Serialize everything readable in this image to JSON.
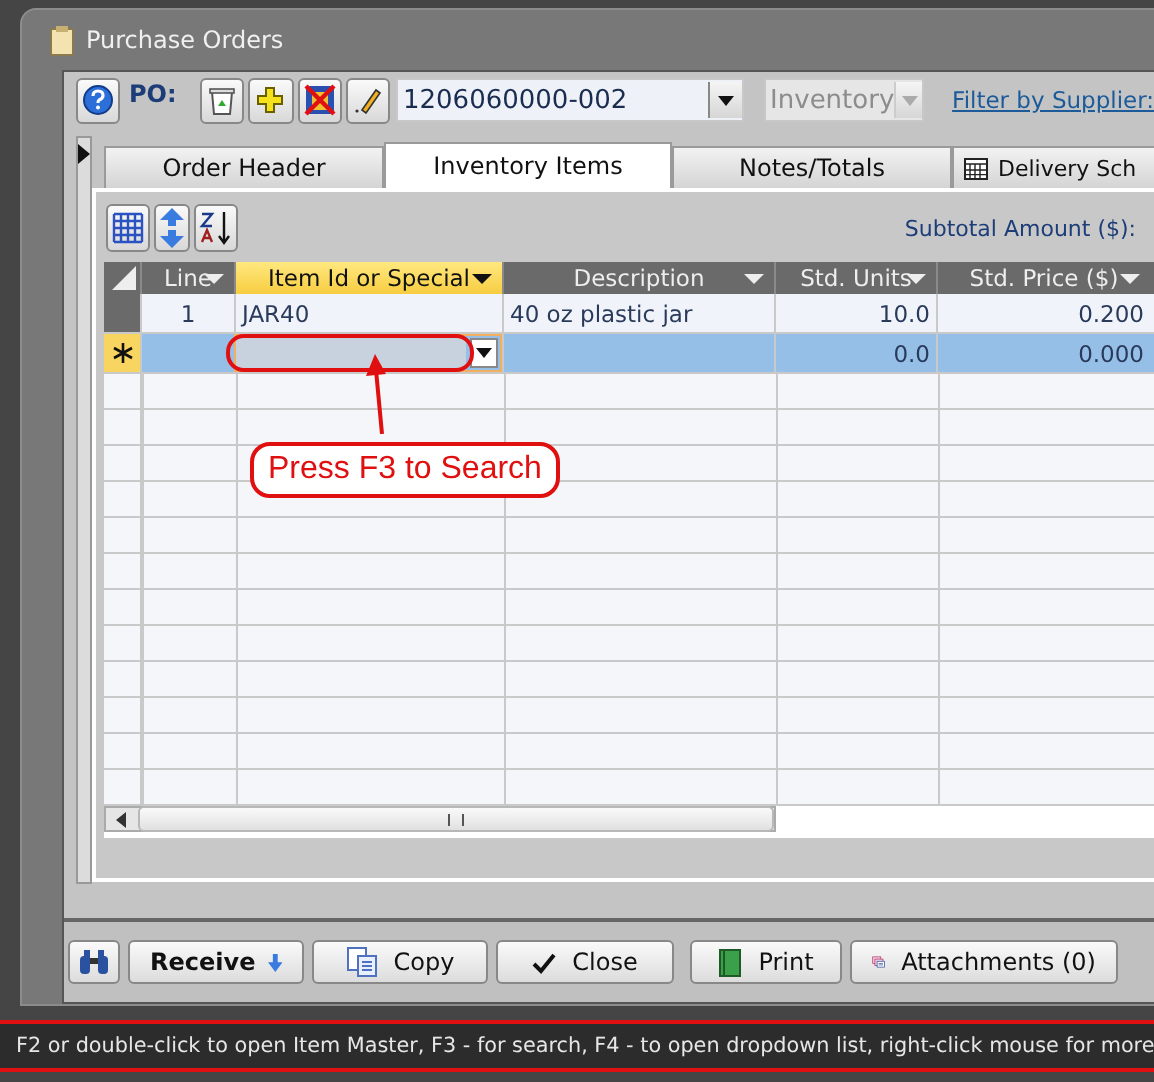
{
  "window": {
    "title": "Purchase Orders"
  },
  "toolbar": {
    "po_label": "PO:",
    "po_number": "1206060000-002",
    "type": "Inventory",
    "type_disabled": true,
    "filter_link": "Filter by Supplier:"
  },
  "tabs": [
    {
      "label": "Order Header",
      "selected": false
    },
    {
      "label": "Inventory Items",
      "selected": true
    },
    {
      "label": "Notes/Totals",
      "selected": false
    },
    {
      "label": "Delivery Sch",
      "selected": false
    }
  ],
  "subtotal_label": "Subtotal Amount ($):",
  "table": {
    "columns": [
      {
        "label": "Line",
        "selected": false
      },
      {
        "label": "Item Id or Special",
        "selected": true
      },
      {
        "label": "Description",
        "selected": false
      },
      {
        "label": "Std. Units",
        "selected": false
      },
      {
        "label": "Std. Price ($)",
        "selected": false
      }
    ],
    "rows": [
      {
        "kind": "record",
        "selected": false,
        "line": "1",
        "item": "JAR40",
        "description": "40 oz plastic jar",
        "std_units": "10.0",
        "std_price": "0.200"
      },
      {
        "kind": "new",
        "selected": true,
        "std_units": "0.0",
        "std_price": "0.000"
      }
    ]
  },
  "callout": "Press F3 to Search",
  "buttons": [
    {
      "kind": "find"
    },
    {
      "kind": "receive",
      "label": "Receive"
    },
    {
      "kind": "copy",
      "label": "Copy"
    },
    {
      "kind": "close",
      "label": "Close"
    },
    {
      "kind": "print",
      "label": "Print"
    },
    {
      "kind": "attachments",
      "label": "Attachments (0)"
    }
  ],
  "status_bar": "F2 or double-click to open Item Master, F3 - for search, F4 - to open dropdown list, right-click mouse for more"
}
